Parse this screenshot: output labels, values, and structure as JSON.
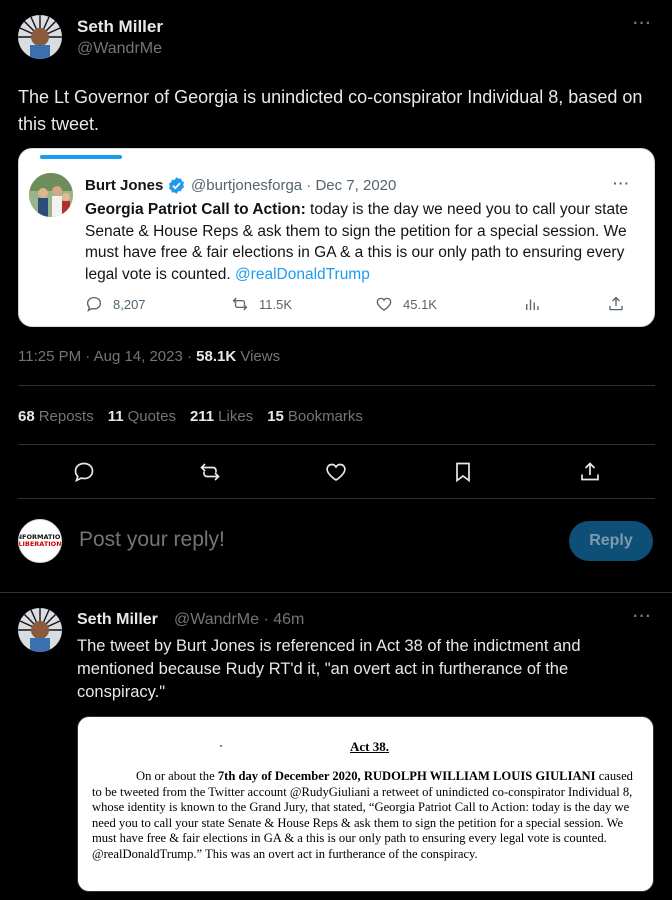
{
  "main_tweet": {
    "name": "Seth Miller",
    "handle": "@WandrMe",
    "more": "···",
    "text": "The Lt Governor of Georgia is unindicted co-conspirator Individual 8, based on this tweet.",
    "timestamp": "11:25 PM · Aug 14, 2023 · ",
    "views_count": "58.1K",
    "views_label": " Views"
  },
  "quoted_tweet": {
    "name": "Burt Jones",
    "handle_date": "@burtjonesforga · Dec 7, 2020",
    "more": "···",
    "bold_text": "Georgia Patriot Call to Action:",
    "text": " today is the day we need you to call your state Senate & House Reps & ask them to sign the petition for a special session. We must have free & fair elections in GA & a this is our only path to ensuring every legal vote is counted. ",
    "mention": "@realDonaldTrump",
    "actions": {
      "replies": "8,207",
      "retweets": "11.5K",
      "likes": "45.1K"
    }
  },
  "stats": {
    "reposts_count": "68",
    "reposts_label": "Reposts",
    "quotes_count": "11",
    "quotes_label": "Quotes",
    "likes_count": "211",
    "likes_label": "Likes",
    "bookmarks_count": "15",
    "bookmarks_label": "Bookmarks"
  },
  "composer": {
    "avatar_line1": "INFORMATION",
    "avatar_line2": "LIBERATION",
    "placeholder": "Post your reply!",
    "reply_label": "Reply"
  },
  "reply_tweet": {
    "name": "Seth Miller",
    "handle_time": "@WandrMe · 46m",
    "more": "···",
    "text": "The tweet by Burt Jones is referenced in Act 38 of the indictment and mentioned because Rudy RT'd it, \"an overt act in furtherance of the conspiracy.\"",
    "doc_title": "Act 38.",
    "doc_intro": "On or about the ",
    "doc_bold1": "7th day of December 2020, RUDOLPH WILLIAM LOUIS GIULIANI",
    "doc_body": " caused to be tweeted from the Twitter account @RudyGiuliani a retweet of unindicted co-conspirator Individual 8, whose identity is known to the Grand Jury, that stated, “Georgia Patriot Call to Action: today is the day we need you to call your state Senate & House Reps & ask them to sign the petition for a special session. We must have free & fair elections in GA & a this is our only path to ensuring every legal vote is counted. @realDonaldTrump.” This was an overt act in furtherance of the conspiracy."
  },
  "colors": {
    "background": "#000000",
    "text": "#e7e9ea",
    "secondary": "#71767b",
    "accent": "#1d9bf0",
    "reply_button": "#0e4f78"
  }
}
